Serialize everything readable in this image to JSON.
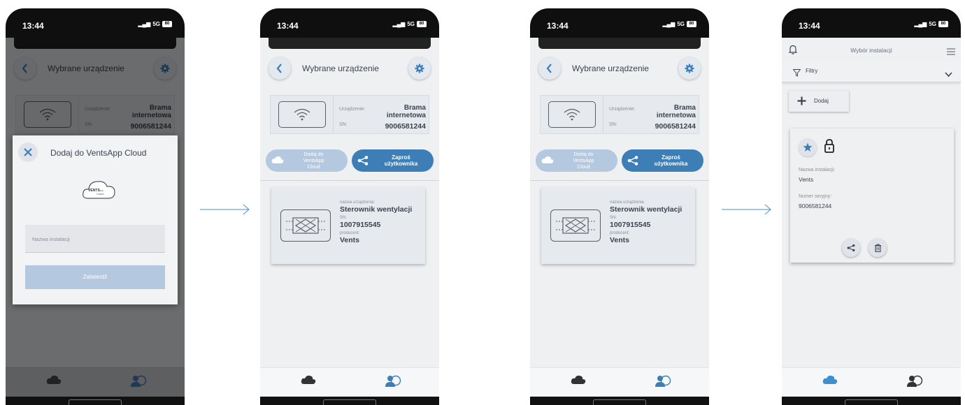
{
  "status": {
    "time": "13:44",
    "network": "5G",
    "battery": "80"
  },
  "device_screen": {
    "title": "Wybrane urządzenie",
    "gateway": {
      "device_label": "Urządzenie:",
      "device_value": "Brama internetowa",
      "sn_label": "SN:",
      "sn_value": "9006581244"
    },
    "cloud_button": "Dodaj do VentsApp Cloud",
    "invite_button": "Zaproś użytkownika",
    "controller": {
      "name_label": "nazwa urządzenia:",
      "name_value": "Sterownik wentylacji",
      "sn_label": "SN:",
      "sn_value": "1007915545",
      "maker_label": "producent:",
      "maker_value": "Vents"
    }
  },
  "dialog": {
    "title": "Dodaj do VentsApp Cloud",
    "logo_text": "VENTS App Cloud",
    "input_placeholder": "Nazwa instalacji",
    "confirm_button": "Zatwierdź"
  },
  "installation_screen": {
    "title": "Wybór instalacji",
    "filter_label": "Filtry",
    "add_button": "Dodaj",
    "name_label": "Nazwa instalacji:",
    "name_value": "Vents",
    "serial_label": "Numer seryjny:",
    "serial_value": "9006581244"
  },
  "colors": {
    "accent": "#3e7eb7",
    "accent_light": "#b4c9df",
    "card": "#e6e9ed",
    "arrow": "#4a90c8"
  }
}
